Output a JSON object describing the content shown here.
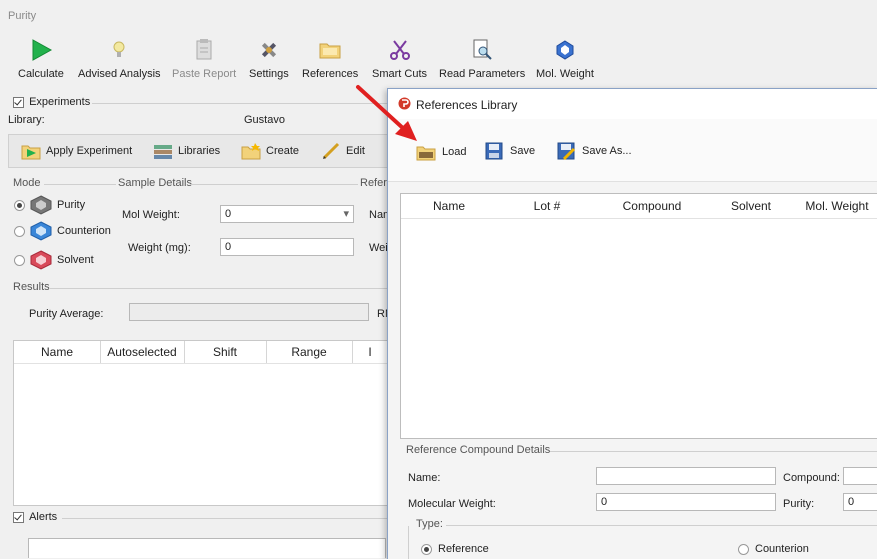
{
  "app": {
    "title": "Purity"
  },
  "toolbar": {
    "calculate": "Calculate",
    "advised_analysis": "Advised Analysis",
    "paste_report": "Paste Report",
    "settings": "Settings",
    "references": "References",
    "smart_cuts": "Smart Cuts",
    "read_parameters": "Read Parameters",
    "mol_weight": "Mol. Weight"
  },
  "experiments": {
    "label": "Experiments",
    "checked": true,
    "library_label": "Library:",
    "library_value": "Gustavo",
    "buttons": {
      "apply": "Apply Experiment",
      "libraries": "Libraries",
      "create": "Create",
      "edit": "Edit"
    }
  },
  "mode": {
    "label": "Mode",
    "options": [
      "Purity",
      "Counterion",
      "Solvent"
    ],
    "selected": "Purity"
  },
  "sample_details": {
    "label": "Sample Details",
    "mol_weight_label": "Mol Weight:",
    "mol_weight_value": "0",
    "weight_label": "Weight (mg):",
    "weight_value": "0"
  },
  "reference_partial": {
    "label": "Refer",
    "name": "Nam",
    "weight": "Wei"
  },
  "results": {
    "label": "Results",
    "purity_average_label": "Purity Average:",
    "rm_partial": "RM",
    "columns": [
      "Name",
      "Autoselected",
      "Shift",
      "Range",
      "I"
    ]
  },
  "alerts": {
    "label": "Alerts",
    "checked": true
  },
  "dialog": {
    "title": "References Library",
    "toolbar": {
      "load": "Load",
      "save": "Save",
      "save_as": "Save As..."
    },
    "columns": [
      "Name",
      "Lot #",
      "Compound",
      "Solvent",
      "Mol. Weight"
    ],
    "details": {
      "label": "Reference Compound Details",
      "name_label": "Name:",
      "name_value": "",
      "compound_label": "Compound:",
      "mol_weight_label": "Molecular Weight:",
      "mol_weight_value": "0",
      "purity_label": "Purity:",
      "purity_value": "0",
      "type_label": "Type:",
      "type_options": [
        "Reference",
        "Counterion"
      ],
      "type_selected": "Reference"
    }
  },
  "colors": {
    "arrow": "#e02020",
    "calculate_green": "#22b14c",
    "dialog_border": "#8aa2c6"
  }
}
